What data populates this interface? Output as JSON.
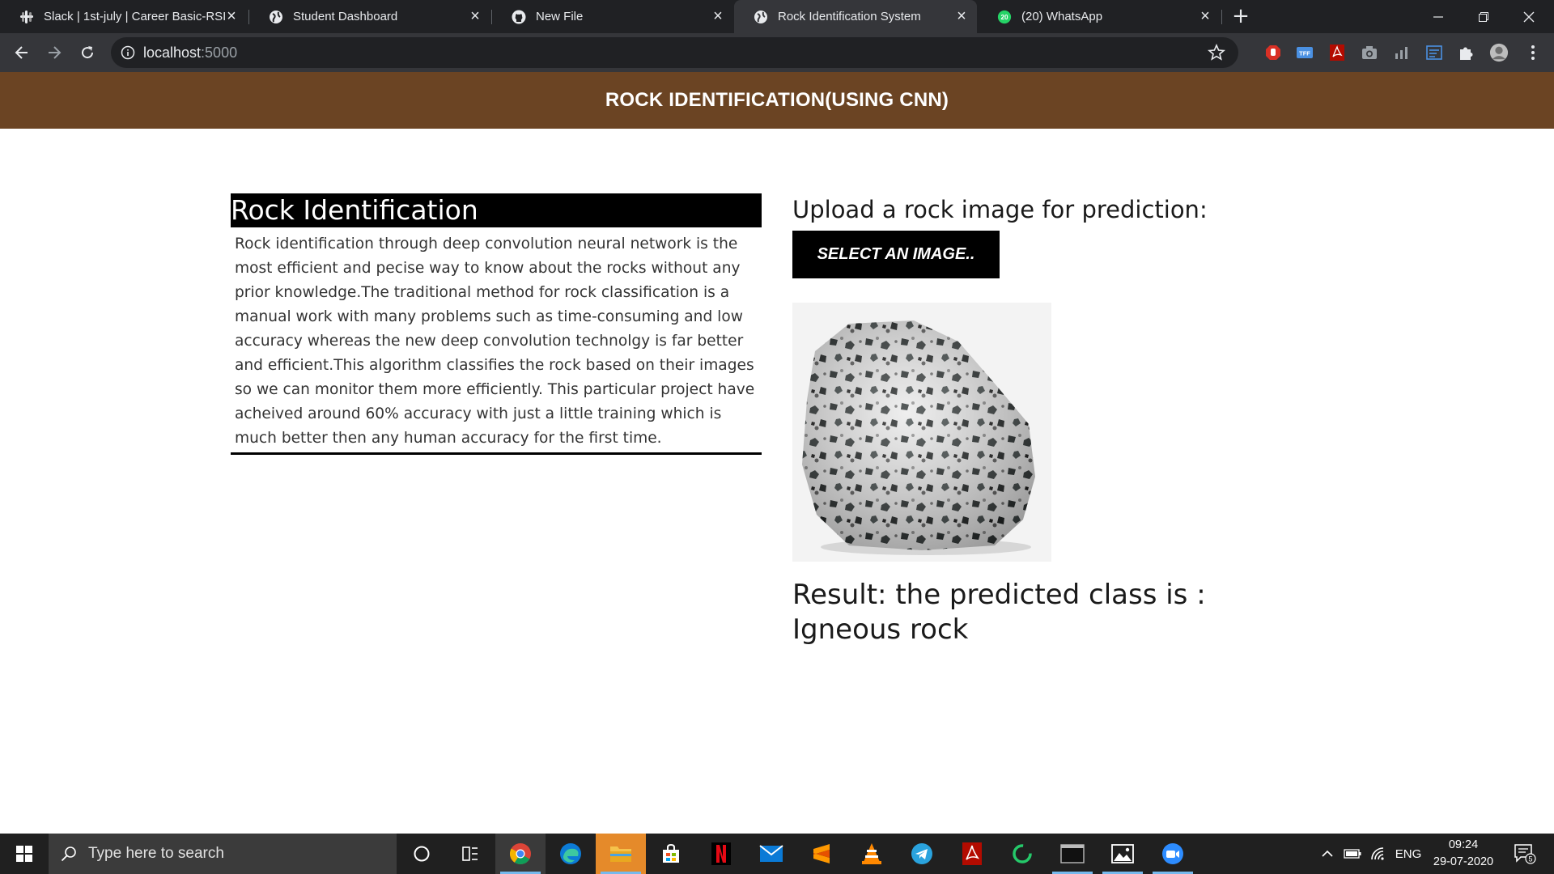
{
  "browser": {
    "tabs": [
      {
        "title": "Slack | 1st-july | Career Basic-RSII",
        "icon": "slack-icon",
        "active": false
      },
      {
        "title": "Student Dashboard",
        "icon": "globe-icon",
        "active": false
      },
      {
        "title": "New File",
        "icon": "github-icon",
        "active": false
      },
      {
        "title": "Rock Identification System",
        "icon": "globe-icon",
        "active": true
      },
      {
        "title": "(20) WhatsApp",
        "icon": "whatsapp-icon",
        "active": false
      }
    ],
    "whatsapp_badge": "20",
    "url_host": "localhost",
    "url_port": ":5000",
    "extensions": [
      "adblock-icon",
      "tff-icon",
      "acrobat-icon",
      "camera-icon",
      "analytics-icon",
      "reader-icon",
      "puzzle-icon",
      "profile-avatar",
      "menu-icon"
    ],
    "ext_tff_label": "TFF"
  },
  "page": {
    "header_title": "ROCK IDENTIFICATION(USING CNN)",
    "left_title": "Rock Identification",
    "description": "Rock identification through deep convolution neural network is the most efficient and pecise way to know about the rocks without any prior knowledge.The traditional method for rock classification is a manual work with many problems such as time-consuming and low accuracy whereas the new deep convolution technolgy is far better and efficient.This algorithm classifies the rock based on their images so we can monitor them more efficiently. This particular project have acheived around 60% accuracy with just a little training which is much better then any human accuracy for the first time.",
    "upload_label": "Upload a rock image for prediction:",
    "upload_button": "SELECT AN IMAGE..",
    "result_text": "Result: the predicted class is : Igneous rock"
  },
  "taskbar": {
    "search_placeholder": "Type here to search",
    "apps": [
      "cortana-icon",
      "task-view-icon",
      "chrome-icon",
      "edge-icon",
      "file-explorer-icon",
      "store-icon",
      "netflix-icon",
      "mail-icon",
      "sublime-icon",
      "vlc-icon",
      "telegram-icon",
      "acrobat-icon",
      "loader-icon",
      "terminal-icon",
      "photos-icon",
      "zoom-icon"
    ],
    "lang": "ENG",
    "time": "09:24",
    "date": "29-07-2020",
    "notification_count": "5"
  },
  "colors": {
    "header_bg": "#6b4423",
    "tab_bar": "#202124",
    "toolbar": "#35363a",
    "black_block": "#000000"
  }
}
